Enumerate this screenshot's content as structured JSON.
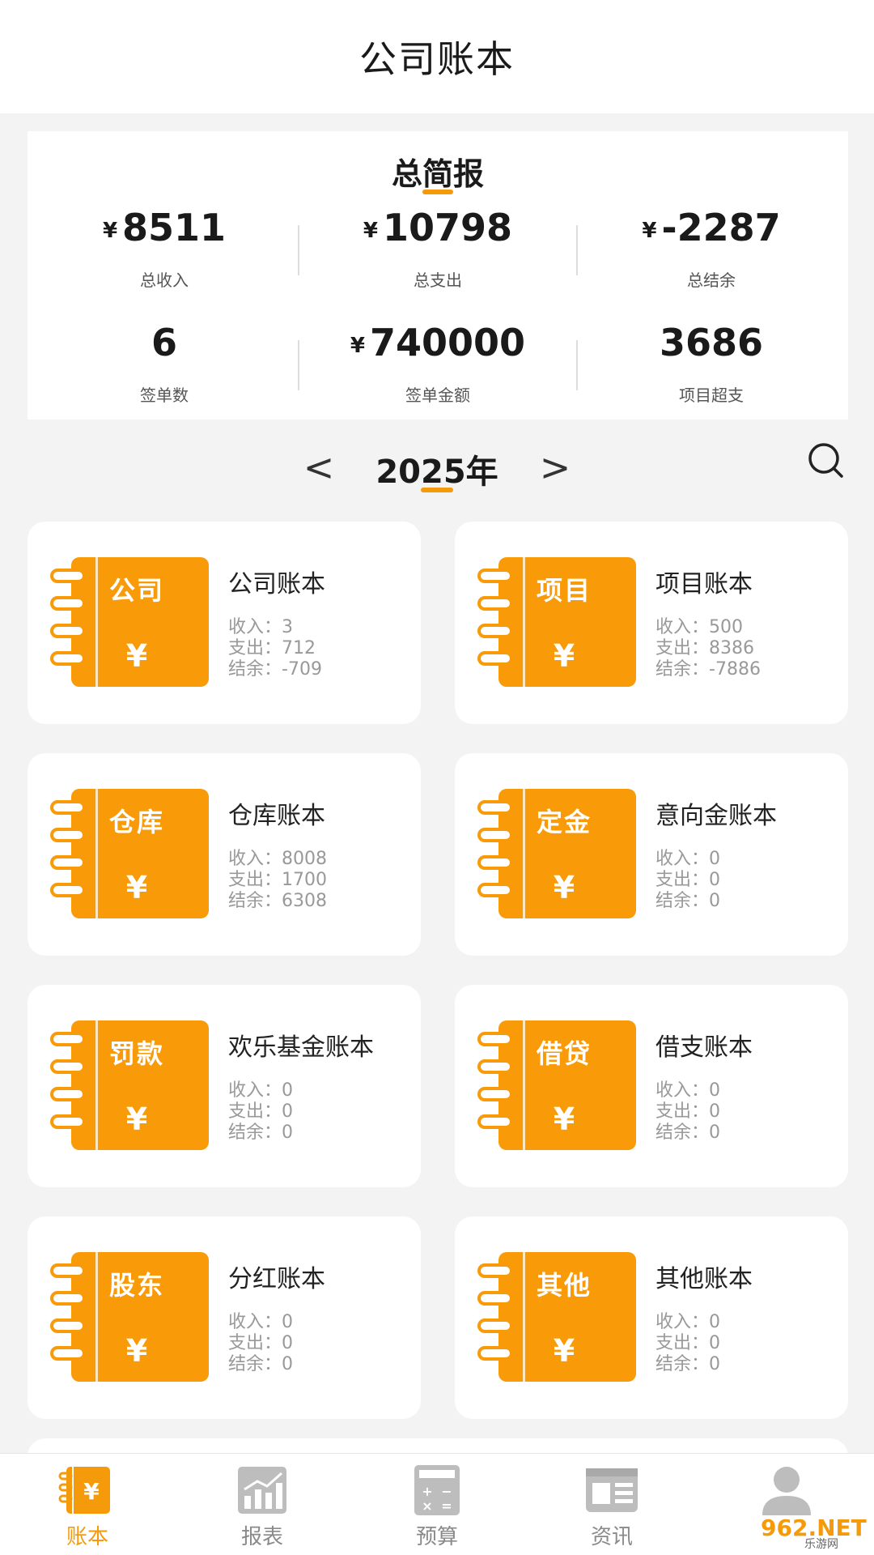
{
  "header": {
    "title": "公司账本"
  },
  "summary": {
    "title": "总简报",
    "currency": "¥",
    "stats": [
      {
        "value": "8511",
        "label": "总收入",
        "currency": true
      },
      {
        "value": "10798",
        "label": "总支出",
        "currency": true
      },
      {
        "value": "-2287",
        "label": "总结余",
        "currency": true
      },
      {
        "value": "6",
        "label": "签单数",
        "currency": false
      },
      {
        "value": "740000",
        "label": "签单金额",
        "currency": true
      },
      {
        "value": "3686",
        "label": "项目超支",
        "currency": false
      }
    ]
  },
  "year": {
    "label": "2025年",
    "prev": "<",
    "next": ">"
  },
  "ledger": {
    "income_label": "收入：",
    "expense_label": "支出：",
    "balance_label": "结余：",
    "yen": "¥",
    "cards": [
      {
        "tag": "公司",
        "title": "公司账本",
        "income": "3",
        "expense": "712",
        "balance": "-709"
      },
      {
        "tag": "项目",
        "title": "项目账本",
        "income": "500",
        "expense": "8386",
        "balance": "-7886"
      },
      {
        "tag": "仓库",
        "title": "仓库账本",
        "income": "8008",
        "expense": "1700",
        "balance": "6308"
      },
      {
        "tag": "定金",
        "title": "意向金账本",
        "income": "0",
        "expense": "0",
        "balance": "0"
      },
      {
        "tag": "罚款",
        "title": "欢乐基金账本",
        "income": "0",
        "expense": "0",
        "balance": "0"
      },
      {
        "tag": "借贷",
        "title": "借支账本",
        "income": "0",
        "expense": "0",
        "balance": "0"
      },
      {
        "tag": "股东",
        "title": "分红账本",
        "income": "0",
        "expense": "0",
        "balance": "0"
      },
      {
        "tag": "其他",
        "title": "其他账本",
        "income": "0",
        "expense": "0",
        "balance": "0"
      }
    ]
  },
  "tabbar": {
    "tabs": [
      {
        "label": "账本",
        "icon": "ledger-icon"
      },
      {
        "label": "报表",
        "icon": "chart-icon"
      },
      {
        "label": "预算",
        "icon": "calculator-icon"
      },
      {
        "label": "资讯",
        "icon": "news-icon"
      },
      {
        "label": "",
        "icon": "profile-icon"
      }
    ],
    "active_index": 0
  },
  "watermark": {
    "text": "962.NET",
    "sub": "乐游网"
  },
  "colors": {
    "accent": "#f59a0a",
    "book": "#f99a08",
    "inactive_icon": "#bdbdbd"
  }
}
